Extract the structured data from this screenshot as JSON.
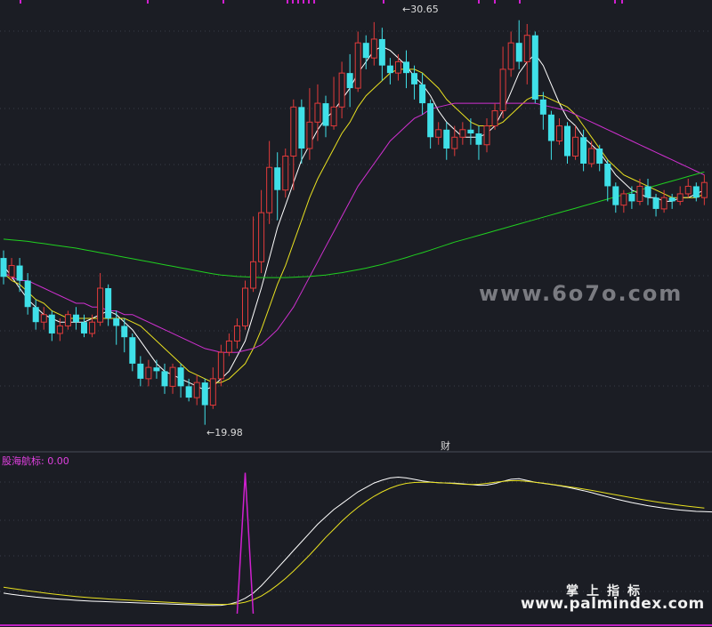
{
  "labels": {
    "high": "30.65",
    "low": "19.98",
    "finance_marker": "财",
    "indicator": "股海航标: 0.00"
  },
  "watermarks": {
    "site1": "www.6o7o.com",
    "brand_cn": "掌上指标",
    "site2": "www.palmindex.com"
  },
  "colors": {
    "background": "#1b1d24",
    "up": "#e23b3b",
    "down": "#3fe0e8",
    "ma5": "#ffffff",
    "ma10": "#e8e020",
    "ma30": "#d030d0",
    "ma60": "#20d020",
    "indicator": "#d020d0"
  },
  "chart_data": [
    {
      "type": "candlestick",
      "title": "",
      "price_range": [
        19.5,
        31.0
      ],
      "high_marker": 30.65,
      "low_marker": 19.98,
      "candles": [
        [
          24.4,
          23.9,
          24.6,
          23.7
        ],
        [
          23.9,
          24.2,
          24.4,
          23.8
        ],
        [
          24.2,
          23.8,
          24.4,
          23.5
        ],
        [
          23.8,
          23.1,
          24.0,
          22.9
        ],
        [
          23.1,
          22.7,
          23.3,
          22.5
        ],
        [
          22.7,
          22.9,
          23.1,
          22.5
        ],
        [
          22.9,
          22.4,
          23.0,
          22.2
        ],
        [
          22.4,
          22.6,
          22.8,
          22.2
        ],
        [
          22.6,
          22.9,
          23.0,
          22.5
        ],
        [
          22.9,
          22.7,
          23.1,
          22.5
        ],
        [
          22.7,
          22.4,
          22.9,
          22.3
        ],
        [
          22.4,
          22.7,
          22.9,
          22.3
        ],
        [
          22.7,
          23.6,
          24.0,
          22.6
        ],
        [
          23.6,
          22.8,
          23.7,
          22.6
        ],
        [
          22.8,
          22.6,
          23.0,
          22.1
        ],
        [
          22.6,
          22.3,
          22.8,
          21.9
        ],
        [
          22.3,
          21.6,
          22.4,
          21.4
        ],
        [
          21.6,
          21.2,
          21.8,
          21.0
        ],
        [
          21.2,
          21.5,
          21.7,
          21.0
        ],
        [
          21.5,
          21.4,
          21.7,
          21.2
        ],
        [
          21.4,
          21.0,
          21.6,
          20.8
        ],
        [
          21.0,
          21.5,
          21.6,
          20.8
        ],
        [
          21.5,
          21.0,
          21.6,
          20.7
        ],
        [
          21.0,
          20.7,
          21.2,
          20.6
        ],
        [
          20.7,
          21.1,
          21.3,
          20.5
        ],
        [
          21.1,
          20.5,
          21.2,
          19.98
        ],
        [
          20.5,
          21.2,
          21.5,
          20.4
        ],
        [
          21.2,
          21.9,
          22.1,
          21.0
        ],
        [
          21.9,
          22.2,
          22.4,
          21.8
        ],
        [
          22.2,
          22.6,
          22.8,
          22.0
        ],
        [
          22.6,
          23.6,
          23.8,
          22.5
        ],
        [
          23.6,
          24.3,
          25.5,
          23.5
        ],
        [
          24.3,
          25.6,
          26.2,
          24.0
        ],
        [
          25.6,
          26.8,
          27.5,
          25.3
        ],
        [
          26.8,
          26.2,
          27.2,
          25.4
        ],
        [
          26.2,
          27.1,
          27.3,
          26.0
        ],
        [
          27.1,
          28.4,
          28.6,
          26.2
        ],
        [
          28.4,
          27.3,
          28.6,
          26.9
        ],
        [
          27.3,
          28.0,
          28.9,
          27.0
        ],
        [
          28.0,
          28.5,
          29.0,
          27.5
        ],
        [
          28.5,
          27.9,
          28.7,
          27.6
        ],
        [
          27.9,
          28.4,
          29.2,
          27.8
        ],
        [
          28.4,
          29.3,
          29.6,
          28.1
        ],
        [
          29.3,
          28.9,
          29.8,
          28.4
        ],
        [
          28.9,
          30.1,
          30.4,
          28.8
        ],
        [
          30.1,
          29.7,
          30.3,
          29.4
        ],
        [
          29.7,
          30.2,
          30.65,
          29.5
        ],
        [
          30.2,
          29.5,
          30.5,
          29.1
        ],
        [
          29.5,
          29.3,
          29.7,
          29.0
        ],
        [
          29.3,
          29.6,
          29.8,
          29.1
        ],
        [
          29.6,
          29.3,
          29.9,
          28.9
        ],
        [
          29.3,
          29.0,
          29.5,
          28.6
        ],
        [
          29.0,
          28.5,
          29.3,
          28.2
        ],
        [
          28.5,
          27.6,
          28.6,
          27.3
        ],
        [
          27.6,
          27.8,
          28.0,
          27.4
        ],
        [
          27.8,
          27.3,
          28.0,
          27.0
        ],
        [
          27.3,
          27.6,
          27.9,
          27.1
        ],
        [
          27.6,
          27.8,
          28.0,
          27.4
        ],
        [
          27.8,
          27.7,
          28.1,
          27.4
        ],
        [
          27.7,
          27.4,
          27.9,
          27.0
        ],
        [
          27.4,
          27.9,
          28.1,
          27.2
        ],
        [
          27.9,
          28.3,
          28.5,
          27.8
        ],
        [
          28.3,
          29.4,
          30.0,
          28.1
        ],
        [
          29.4,
          30.1,
          30.4,
          29.2
        ],
        [
          30.1,
          29.6,
          30.7,
          29.4
        ],
        [
          29.6,
          30.3,
          30.6,
          29.0
        ],
        [
          30.3,
          28.6,
          30.4,
          28.5
        ],
        [
          28.6,
          28.2,
          28.8,
          27.8
        ],
        [
          28.2,
          27.5,
          28.3,
          27.0
        ],
        [
          27.5,
          27.9,
          28.1,
          27.4
        ],
        [
          27.9,
          27.1,
          28.0,
          26.9
        ],
        [
          27.1,
          27.6,
          27.9,
          27.0
        ],
        [
          27.6,
          26.9,
          27.8,
          26.7
        ],
        [
          26.9,
          27.3,
          27.5,
          26.8
        ],
        [
          27.3,
          26.9,
          27.4,
          26.7
        ],
        [
          26.9,
          26.3,
          27.0,
          25.9
        ],
        [
          26.3,
          25.8,
          26.4,
          25.6
        ],
        [
          25.8,
          26.1,
          26.2,
          25.6
        ],
        [
          26.1,
          25.9,
          26.3,
          25.7
        ],
        [
          25.9,
          26.3,
          26.5,
          25.8
        ],
        [
          26.3,
          26.0,
          26.5,
          25.8
        ],
        [
          26.0,
          25.7,
          26.1,
          25.5
        ],
        [
          25.7,
          26.0,
          26.2,
          25.6
        ],
        [
          26.0,
          25.9,
          26.1,
          25.7
        ],
        [
          25.9,
          26.1,
          26.3,
          25.8
        ],
        [
          26.1,
          26.3,
          26.5,
          26.0
        ],
        [
          26.3,
          26.0,
          26.4,
          25.9
        ],
        [
          26.0,
          26.4,
          26.6,
          25.8
        ]
      ],
      "ma_series": [
        {
          "key": "ma5",
          "values": [
            24.2,
            23.9,
            23.6,
            23.3,
            23.1,
            22.9,
            22.8,
            22.7,
            22.7,
            22.7,
            22.7,
            22.8,
            22.9,
            23.0,
            22.9,
            22.7,
            22.5,
            22.2,
            21.9,
            21.6,
            21.4,
            21.3,
            21.2,
            21.1,
            21.0,
            20.9,
            21.0,
            21.2,
            21.4,
            21.8,
            22.2,
            22.9,
            23.6,
            24.4,
            25.2,
            25.8,
            26.4,
            27.0,
            27.4,
            27.8,
            28.1,
            28.3,
            28.6,
            28.9,
            29.3,
            29.6,
            29.9,
            30.0,
            29.9,
            29.7,
            29.5,
            29.2,
            29.0,
            28.7,
            28.3,
            28.0,
            27.8,
            27.6,
            27.6,
            27.6,
            27.7,
            27.9,
            28.3,
            28.8,
            29.3,
            29.6,
            29.8,
            29.5,
            29.0,
            28.5,
            28.1,
            27.9,
            27.6,
            27.4,
            27.2,
            26.9,
            26.6,
            26.4,
            26.2,
            26.1,
            26.0,
            26.0,
            25.9,
            25.9,
            26.0,
            26.0,
            26.1,
            26.2
          ]
        },
        {
          "key": "ma10",
          "values": [
            24.0,
            23.8,
            23.7,
            23.5,
            23.3,
            23.2,
            23.0,
            22.9,
            22.8,
            22.8,
            22.8,
            22.8,
            22.8,
            22.8,
            22.8,
            22.8,
            22.7,
            22.6,
            22.4,
            22.2,
            22.0,
            21.8,
            21.6,
            21.4,
            21.3,
            21.2,
            21.1,
            21.1,
            21.2,
            21.4,
            21.6,
            22.0,
            22.5,
            23.1,
            23.7,
            24.2,
            24.8,
            25.4,
            26.0,
            26.5,
            26.9,
            27.3,
            27.7,
            28.0,
            28.4,
            28.7,
            28.9,
            29.1,
            29.3,
            29.4,
            29.4,
            29.4,
            29.3,
            29.1,
            28.9,
            28.6,
            28.4,
            28.2,
            28.0,
            27.9,
            27.9,
            27.9,
            28.0,
            28.2,
            28.4,
            28.6,
            28.7,
            28.7,
            28.6,
            28.5,
            28.4,
            28.2,
            27.9,
            27.6,
            27.3,
            27.0,
            26.8,
            26.6,
            26.5,
            26.4,
            26.3,
            26.2,
            26.1,
            26.0,
            26.0,
            26.0,
            26.0,
            26.1
          ]
        },
        {
          "key": "ma30",
          "values": [
            24.0,
            23.9,
            23.8,
            23.8,
            23.7,
            23.6,
            23.5,
            23.4,
            23.3,
            23.2,
            23.2,
            23.1,
            23.1,
            23.0,
            23.0,
            22.9,
            22.9,
            22.8,
            22.7,
            22.6,
            22.5,
            22.4,
            22.3,
            22.2,
            22.1,
            22.0,
            21.95,
            21.9,
            21.9,
            21.9,
            21.95,
            22.0,
            22.1,
            22.3,
            22.5,
            22.8,
            23.1,
            23.5,
            23.9,
            24.3,
            24.7,
            25.1,
            25.5,
            25.9,
            26.3,
            26.6,
            26.9,
            27.2,
            27.5,
            27.7,
            27.9,
            28.1,
            28.2,
            28.35,
            28.4,
            28.45,
            28.5,
            28.5,
            28.5,
            28.5,
            28.5,
            28.5,
            28.5,
            28.5,
            28.5,
            28.5,
            28.5,
            28.45,
            28.4,
            28.35,
            28.3,
            28.2,
            28.1,
            28.0,
            27.9,
            27.8,
            27.7,
            27.6,
            27.5,
            27.4,
            27.3,
            27.2,
            27.1,
            27.0,
            26.9,
            26.8,
            26.7,
            26.6
          ]
        },
        {
          "key": "ma60",
          "values": [
            24.9,
            24.88,
            24.86,
            24.84,
            24.81,
            24.78,
            24.75,
            24.72,
            24.69,
            24.66,
            24.62,
            24.58,
            24.54,
            24.5,
            24.46,
            24.42,
            24.38,
            24.34,
            24.3,
            24.26,
            24.22,
            24.18,
            24.14,
            24.1,
            24.06,
            24.02,
            23.98,
            23.95,
            23.93,
            23.91,
            23.9,
            23.89,
            23.88,
            23.88,
            23.88,
            23.88,
            23.89,
            23.9,
            23.91,
            23.93,
            23.95,
            23.98,
            24.01,
            24.05,
            24.09,
            24.13,
            24.18,
            24.23,
            24.29,
            24.35,
            24.41,
            24.48,
            24.54,
            24.61,
            24.68,
            24.75,
            24.82,
            24.88,
            24.94,
            25.0,
            25.06,
            25.12,
            25.18,
            25.24,
            25.3,
            25.36,
            25.42,
            25.48,
            25.54,
            25.6,
            25.66,
            25.72,
            25.78,
            25.84,
            25.9,
            25.96,
            26.02,
            26.08,
            26.14,
            26.2,
            26.26,
            26.32,
            26.38,
            26.44,
            26.5,
            26.56,
            26.62,
            26.68
          ]
        }
      ]
    },
    {
      "type": "line",
      "title": "股海航标",
      "value": 0.0,
      "ylim": [
        0,
        100
      ],
      "series": [
        {
          "key": "fast",
          "values": [
            14,
            13.2,
            12.5,
            11.9,
            11.3,
            10.8,
            10.3,
            9.9,
            9.5,
            9.1,
            8.8,
            8.5,
            8.3,
            8.1,
            7.9,
            7.7,
            7.5,
            7.3,
            7.1,
            6.9,
            6.7,
            6.5,
            6.3,
            6.1,
            5.9,
            5.7,
            5.6,
            5.7,
            6.5,
            8.0,
            10.5,
            14,
            19,
            25,
            31,
            37,
            43,
            49,
            55,
            61,
            66,
            71,
            75,
            79,
            83,
            86,
            89,
            91,
            92.5,
            93,
            92.5,
            91.5,
            90.5,
            89.7,
            89.2,
            89,
            88.9,
            88.5,
            88,
            87.5,
            87.6,
            88.6,
            90.2,
            91.6,
            92,
            90.8,
            89.6,
            88.8,
            88,
            87.2,
            86.2,
            85,
            83.8,
            82.5,
            81,
            79.6,
            78.2,
            76.9,
            75.7,
            74.6,
            73.6,
            72.7,
            71.9,
            71.2,
            70.6,
            70.1,
            69.7,
            69.5,
            69.3
          ]
        },
        {
          "key": "slow",
          "values": [
            18,
            17.2,
            16.4,
            15.6,
            14.9,
            14.2,
            13.5,
            12.9,
            12.3,
            11.7,
            11.2,
            10.8,
            10.4,
            10.0,
            9.7,
            9.4,
            9.1,
            8.8,
            8.5,
            8.2,
            7.9,
            7.6,
            7.3,
            7.0,
            6.8,
            6.6,
            6.4,
            6.3,
            6.4,
            6.8,
            7.8,
            9.5,
            12,
            15.5,
            19.5,
            24,
            29,
            34.5,
            40,
            46,
            52,
            57.5,
            63,
            68,
            72.5,
            76.5,
            80,
            83,
            85.5,
            87.5,
            88.8,
            89.4,
            89.6,
            89.5,
            89.3,
            89,
            88.6,
            88.2,
            88,
            88.2,
            88.8,
            89.5,
            90.2,
            90.6,
            90.6,
            90.2,
            89.6,
            88.9,
            88.2,
            87.4,
            86.6,
            85.8,
            84.9,
            84,
            83,
            82,
            81,
            80,
            79,
            78,
            77.1,
            76.2,
            75.4,
            74.6,
            73.9,
            73.2,
            72.6,
            72
          ]
        },
        {
          "key": "signal",
          "spike_index": 30,
          "spike_value": 96,
          "base": 0
        }
      ]
    }
  ]
}
